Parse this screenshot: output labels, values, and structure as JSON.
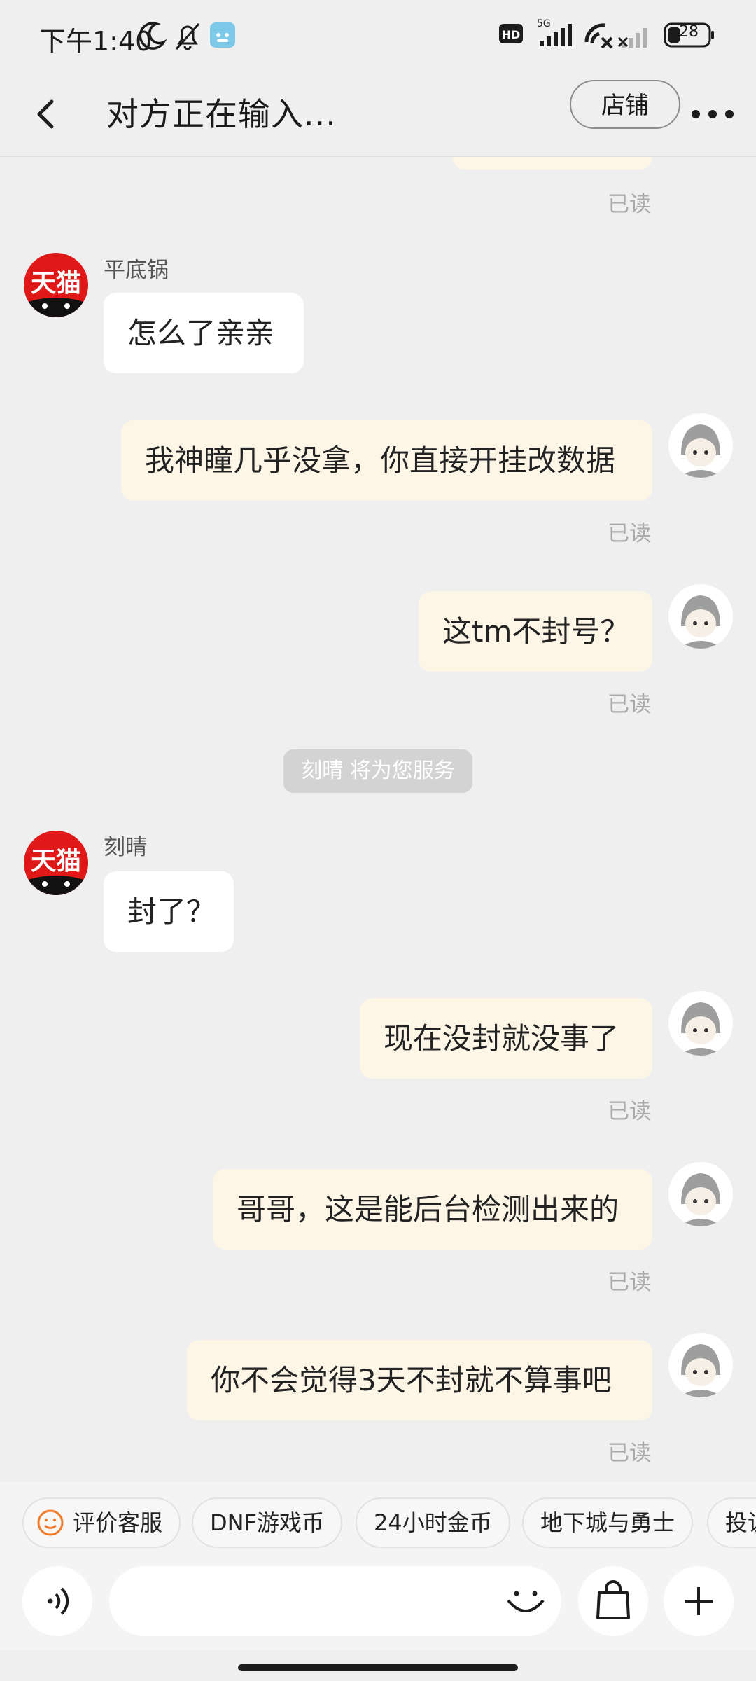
{
  "status_bar": {
    "time": "下午1:40",
    "battery": "28",
    "icons": [
      "moon-icon",
      "bell-off-icon",
      "app-notification-icon",
      "hd-icon",
      "signal-5g-icon",
      "wifi-off-icon",
      "signal-icon",
      "battery-icon"
    ]
  },
  "header": {
    "title": "对方正在输入...",
    "shop_label": "店铺"
  },
  "chat": {
    "read_label": "已读",
    "messages": [
      {
        "sender": "平底锅",
        "text": "怎么了亲亲"
      },
      {
        "text": "我神瞳几乎没拿，你直接开挂改数据"
      },
      {
        "text": "这tm不封号？"
      },
      {
        "text": "刻晴 将为您服务"
      },
      {
        "sender": "刻晴",
        "text": "封了？"
      },
      {
        "text": "现在没封就没事了"
      },
      {
        "text": "哥哥，这是能后台检测出来的"
      },
      {
        "text": "你不会觉得3天不封就不算事吧"
      }
    ],
    "avatar_text": "天猫"
  },
  "quick_chips": [
    "评价客服",
    "DNF游戏币",
    "24小时金币",
    "地下城与勇士",
    "投诉"
  ],
  "colors": {
    "background": "#efefef",
    "my_bubble": "#fdf6e7",
    "their_bubble": "#ffffff",
    "tmall_red": "#e01818",
    "chip_smile": "#f07a2a"
  }
}
